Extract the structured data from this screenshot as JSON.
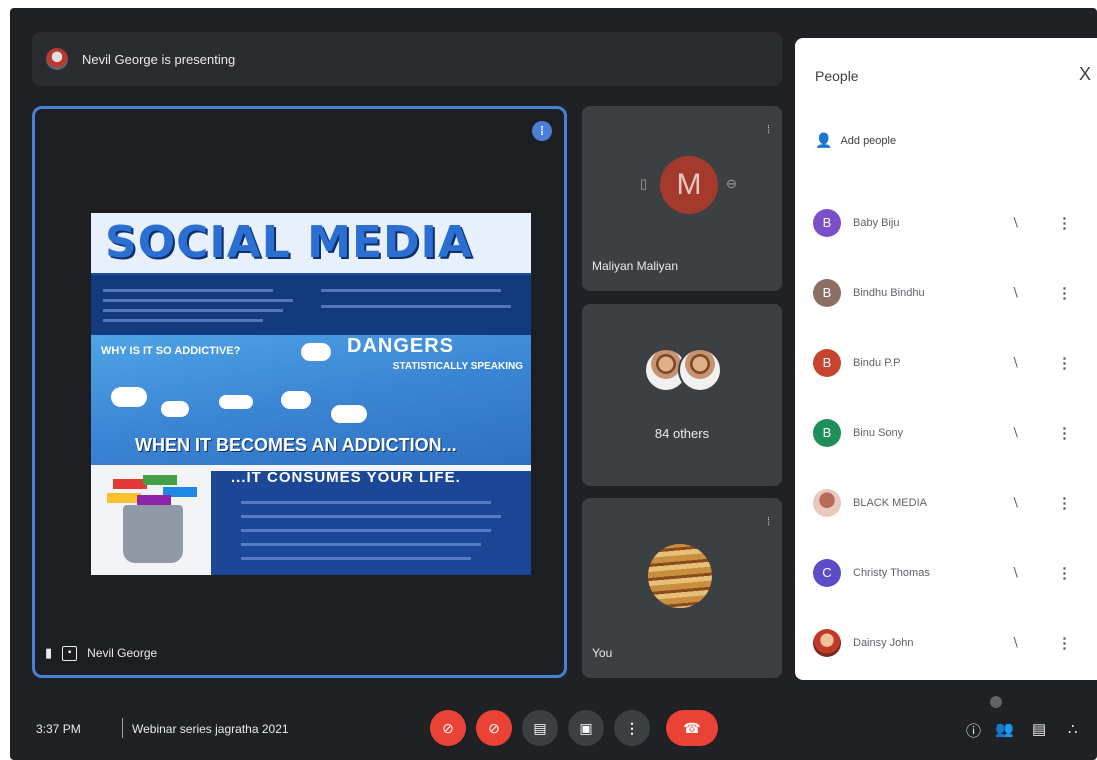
{
  "presenting": {
    "text": "Nevil George is presenting"
  },
  "main_tile": {
    "name": "Nevil George",
    "slide": {
      "title": "SOCIAL MEDIA",
      "why": "WHY IS IT SO ADDICTIVE?",
      "dangers": "DANGERS",
      "stats": "STATISTICALLY SPEAKING",
      "addiction": "WHEN IT BECOMES AN ADDICTION...",
      "consumes": "...IT CONSUMES YOUR LIFE."
    }
  },
  "side_tiles": {
    "maliyan": {
      "initial": "M",
      "name": "Maliyan Maliyan"
    },
    "others": {
      "label": "84 others"
    },
    "you": {
      "name": "You"
    }
  },
  "people_panel": {
    "title": "People",
    "close": "X",
    "add_people": "Add people",
    "people": [
      {
        "initial": "B",
        "name": "Baby Biju",
        "color": "#7b4fc9"
      },
      {
        "initial": "B",
        "name": "Bindhu Bindhu",
        "color": "#8d6e63"
      },
      {
        "initial": "B",
        "name": "Bindu P.P",
        "color": "#c5452e"
      },
      {
        "initial": "B",
        "name": "Binu Sony",
        "color": "#1e8e5a"
      },
      {
        "initial": "",
        "name": "BLACK MEDIA",
        "color": "#e9c8bf"
      },
      {
        "initial": "C",
        "name": "Christy Thomas",
        "color": "#5c4cc7"
      },
      {
        "initial": "",
        "name": "Dainsy John",
        "color": "#d9534f"
      }
    ]
  },
  "bottom_bar": {
    "time": "3:37 PM",
    "meeting_name": "Webinar series jagratha 2021"
  },
  "icons": {
    "mic": "mic-off-icon",
    "camera": "camera-off-icon",
    "captions": "captions-icon",
    "present": "present-icon",
    "more": "more-vert-icon",
    "end_call": "end-call-icon",
    "info": "info-icon",
    "people": "people-icon",
    "chat": "chat-icon",
    "activities": "activities-icon"
  },
  "colors": {
    "accent": "#4a7fd6",
    "danger": "#ea4335",
    "background": "#202124"
  }
}
